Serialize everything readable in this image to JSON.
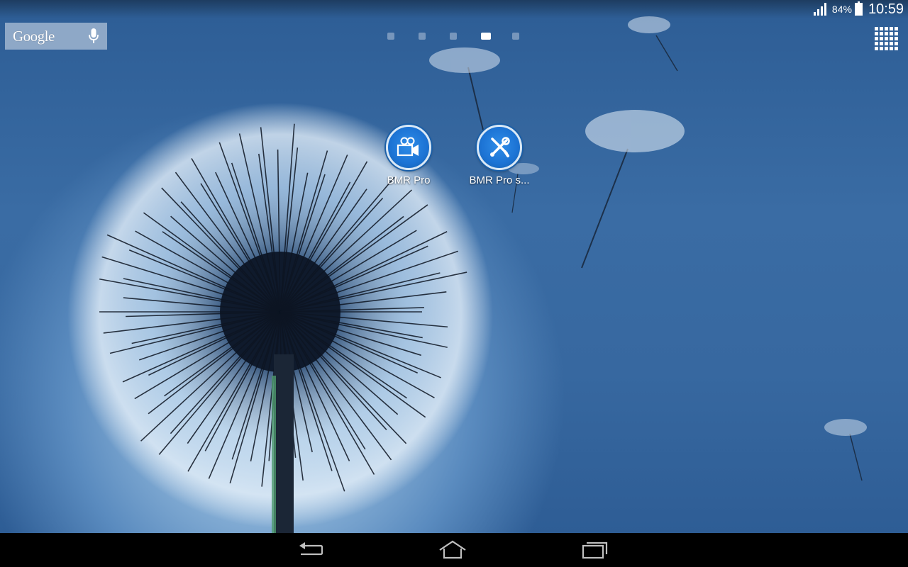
{
  "status_bar": {
    "battery_percent": "84%",
    "time": "10:59",
    "icons": [
      "signal-icon",
      "battery-icon"
    ]
  },
  "search_widget": {
    "logo_text": "Google",
    "icons": [
      "mic-icon"
    ]
  },
  "page_indicator": {
    "total_pages": 5,
    "active_index": 3
  },
  "apps": [
    {
      "label": "BMR Pro",
      "icon": "video-camera-icon"
    },
    {
      "label": "BMR Pro s...",
      "icon": "wrench-screwdriver-icon"
    }
  ],
  "navigation": {
    "buttons": [
      "back-icon",
      "home-icon",
      "recent-apps-icon"
    ]
  },
  "colors": {
    "app_icon_blue": "#1c73d4",
    "navbar": "#000000",
    "wallpaper_blue": "#2f5f96"
  }
}
